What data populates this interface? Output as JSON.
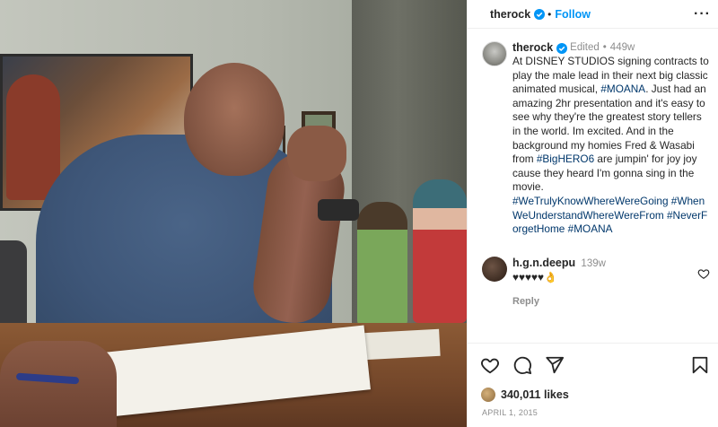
{
  "post": {
    "username": "therock",
    "follow_label": "Follow",
    "separator": "•",
    "more_label": "···"
  },
  "caption": {
    "username": "therock",
    "edited": "Edited",
    "separator": "•",
    "age": "449w",
    "text_1": "At DISNEY STUDIOS signing contracts to play the male lead in their next big classic animated musical, ",
    "tag_moana": "#MOANA",
    "text_2": ". Just had an amazing 2hr presentation and it's easy to see why they're the greatest story tellers in the world. Im excited. And in the background my homies Fred & Wasabi from ",
    "tag_bighero": "#BigHERO6",
    "text_3": " are jumpin' for joy joy cause they heard I'm gonna sing in the movie.",
    "tags_line": "#WeTrulyKnowWhereWereGoing #WhenWeUnderstandWhereWereFrom #NeverForgetHome #MOANA"
  },
  "comment": {
    "username": "h.g.n.deepu",
    "age": "139w",
    "text": "♥♥♥♥♥👌",
    "reply_label": "Reply"
  },
  "actions": {
    "like_icon": "heart-icon",
    "comment_icon": "comment-icon",
    "share_icon": "share-icon",
    "save_icon": "bookmark-icon"
  },
  "likes": {
    "count": "340,011 likes"
  },
  "date": "APRIL 1, 2015",
  "colors": {
    "accent": "#0095f6",
    "verified": "#0095f6",
    "hashtag": "#00376b",
    "muted": "#8e8e8e"
  }
}
